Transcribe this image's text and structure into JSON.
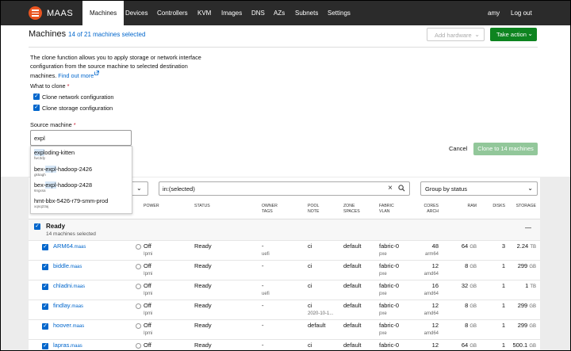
{
  "nav": {
    "brand": "MAAS",
    "items": [
      "Machines",
      "Devices",
      "Controllers",
      "KVM",
      "Images",
      "DNS",
      "AZs",
      "Subnets",
      "Settings"
    ],
    "user": "amy",
    "logout": "Log out"
  },
  "header": {
    "title": "Machines",
    "count": "14 of 21 machines selected",
    "add_hardware": "Add hardware",
    "take_action": "Take action"
  },
  "clone": {
    "description": "The clone function allows you to apply storage or network interface configuration from the source machine to selected destination machines.",
    "find_out_more": "Find out more",
    "what_to_clone": "What to clone",
    "required": "*",
    "option_network": "Clone network configuration",
    "option_storage": "Clone storage configuration",
    "source_label": "Source machine",
    "source_value": "expl",
    "cancel": "Cancel",
    "submit": "Clone to 14 machines"
  },
  "dropdown": {
    "items": [
      {
        "pre": "",
        "match": "expl",
        "post": "oding-kitten",
        "sub": "fwc3dy"
      },
      {
        "pre": "bex-",
        "match": "expl",
        "post": "-hadoop-2426",
        "sub": "gk5agh"
      },
      {
        "pre": "bex-",
        "match": "expl",
        "post": "-hadoop-2428",
        "sub": "6ngxsa"
      },
      {
        "pre": "hmt-bbx-5426-r79-smm-prod",
        "match": "",
        "post": "",
        "sub": "xqnq23aj"
      }
    ]
  },
  "filters": {
    "search_value": "in:(selected)",
    "group_by": "Group by status"
  },
  "columns": {
    "power": "POWER",
    "status": "STATUS",
    "owner": "OWNER",
    "tags": "TAGS",
    "pool": "POOL",
    "note": "NOTE",
    "zone": "ZONE",
    "spaces": "SPACES",
    "fabric": "FABRIC",
    "vlan": "VLAN",
    "cores": "CORES",
    "arch": "ARCH",
    "ram": "RAM",
    "disks": "DISKS",
    "storage": "STORAGE"
  },
  "group": {
    "name": "Ready",
    "subtitle": "14 machines selected",
    "dash": "—"
  },
  "machines": [
    {
      "host": "ARM64",
      "domain": ".maas",
      "power": "Off",
      "power_type": "Ipmi",
      "status": "Ready",
      "owner": "-",
      "tags": "uefi",
      "pool": "ci",
      "note": "",
      "zone": "default",
      "fabric": "fabric-0",
      "vlan": "pxe",
      "cores": "48",
      "arch": "arm64",
      "ram": "64",
      "ram_unit": "GB",
      "disks": "3",
      "storage": "2.24",
      "storage_unit": "TB"
    },
    {
      "host": "biddle",
      "domain": ".maas",
      "power": "Off",
      "power_type": "Ipmi",
      "status": "Ready",
      "owner": "-",
      "tags": "",
      "pool": "ci",
      "note": "",
      "zone": "default",
      "fabric": "fabric-0",
      "vlan": "pxe",
      "cores": "12",
      "arch": "amd64",
      "ram": "8",
      "ram_unit": "GB",
      "disks": "1",
      "storage": "299",
      "storage_unit": "GB"
    },
    {
      "host": "chladni",
      "domain": ".maas",
      "power": "Off",
      "power_type": "Ipmi",
      "status": "Ready",
      "owner": "-",
      "tags": "uefi",
      "pool": "ci",
      "note": "",
      "zone": "default",
      "fabric": "fabric-0",
      "vlan": "pxe",
      "cores": "16",
      "arch": "amd64",
      "ram": "32",
      "ram_unit": "GB",
      "disks": "1",
      "storage": "1",
      "storage_unit": "TB"
    },
    {
      "host": "findlay",
      "domain": ".maas",
      "power": "Off",
      "power_type": "Ipmi",
      "status": "Ready",
      "owner": "-",
      "tags": "",
      "pool": "ci",
      "note": "2020-10-1...",
      "zone": "default",
      "fabric": "fabric-0",
      "vlan": "pxe",
      "cores": "12",
      "arch": "amd64",
      "ram": "8",
      "ram_unit": "GB",
      "disks": "1",
      "storage": "299",
      "storage_unit": "GB"
    },
    {
      "host": "hoover",
      "domain": ".maas",
      "power": "Off",
      "power_type": "Ipmi",
      "status": "Ready",
      "owner": "-",
      "tags": "",
      "pool": "default",
      "note": "",
      "zone": "default",
      "fabric": "fabric-0",
      "vlan": "pxe",
      "cores": "12",
      "arch": "amd64",
      "ram": "8",
      "ram_unit": "GB",
      "disks": "1",
      "storage": "299",
      "storage_unit": "GB"
    },
    {
      "host": "lapras",
      "domain": ".maas",
      "power": "Off",
      "power_type": "",
      "status": "Ready",
      "owner": "-",
      "tags": "",
      "pool": "ci",
      "note": "",
      "zone": "default",
      "fabric": "fabric-0",
      "vlan": "",
      "cores": "12",
      "arch": "",
      "ram": "64",
      "ram_unit": "GB",
      "disks": "1",
      "storage": "500.1",
      "storage_unit": "GB"
    }
  ],
  "colors": {
    "nav_bg": "#2b2b2b",
    "brand_orange": "#e95420",
    "link_blue": "#0066cc",
    "action_green": "#0e8420",
    "disabled_green": "#92c79a",
    "required_red": "#c7162b"
  },
  "icons": [
    "maas-logo-icon",
    "chevron-down-icon",
    "external-link-icon",
    "checkbox-checked-icon",
    "clear-icon",
    "search-icon",
    "power-icon"
  ]
}
